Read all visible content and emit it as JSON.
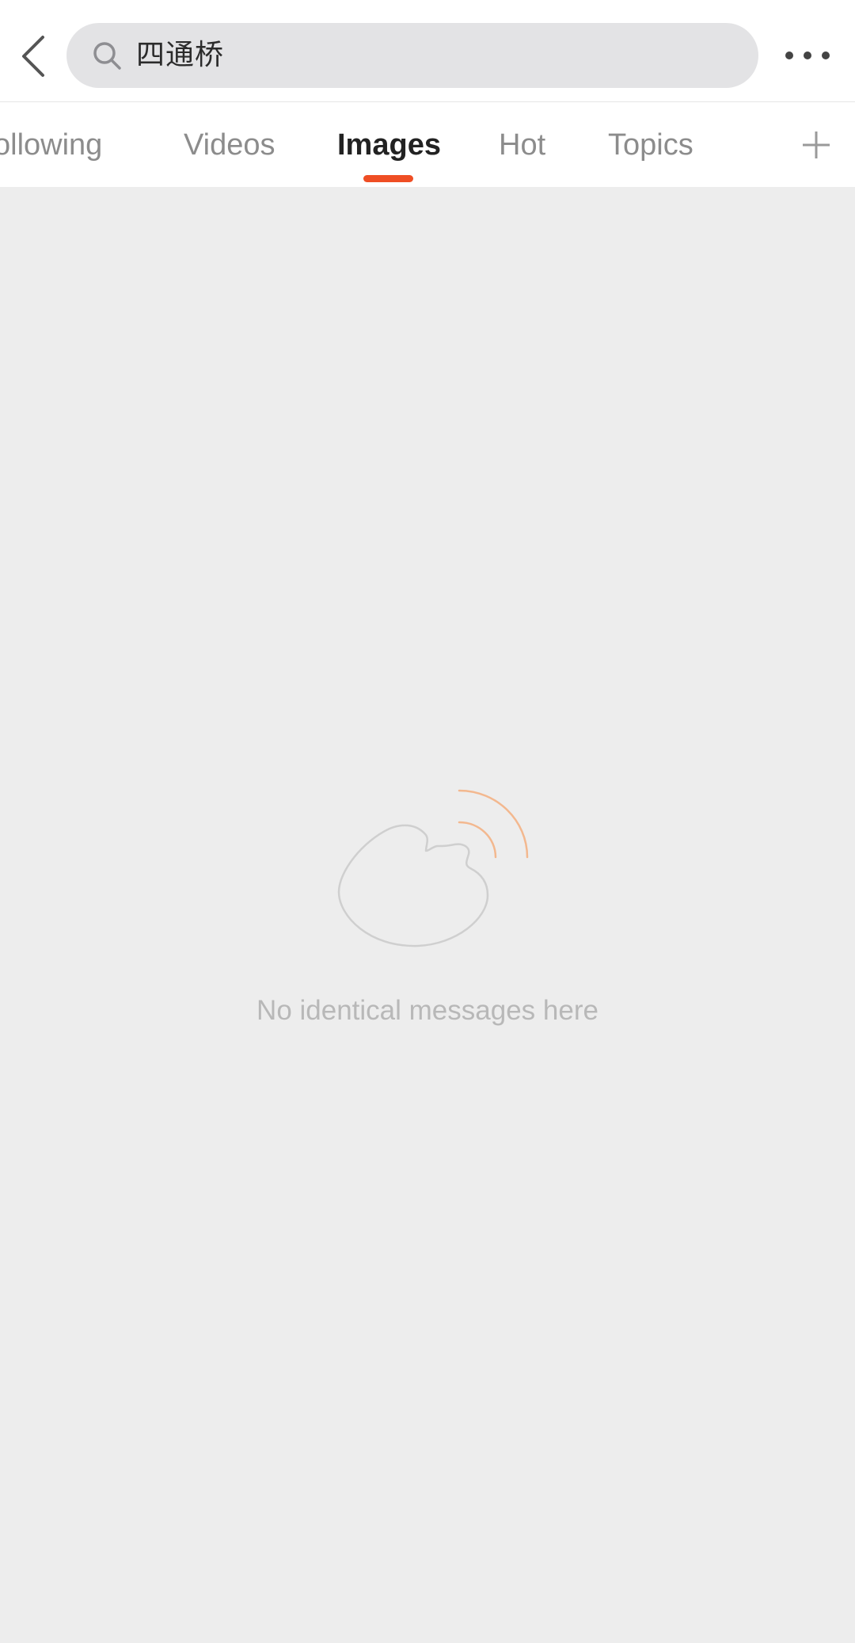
{
  "header": {
    "search_query": "四通桥",
    "icons": {
      "back": "back-chevron-icon",
      "search": "search-icon",
      "more": "more-dots-icon"
    }
  },
  "tabs": [
    {
      "label": "Following",
      "visible_text": "ollowing",
      "active": false
    },
    {
      "label": "Videos",
      "active": false
    },
    {
      "label": "Images",
      "active": true
    },
    {
      "label": "Hot",
      "active": false
    },
    {
      "label": "Topics",
      "active": false
    }
  ],
  "tab_actions": {
    "add_icon": "plus-icon"
  },
  "empty_state": {
    "message": "No identical messages here",
    "illustration": "weibo-eye-logo-icon"
  },
  "colors": {
    "accent": "#ef4e24",
    "illustration_signal": "#f3b88f",
    "illustration_outline": "#cfcfcf",
    "page_background": "#ededed"
  }
}
